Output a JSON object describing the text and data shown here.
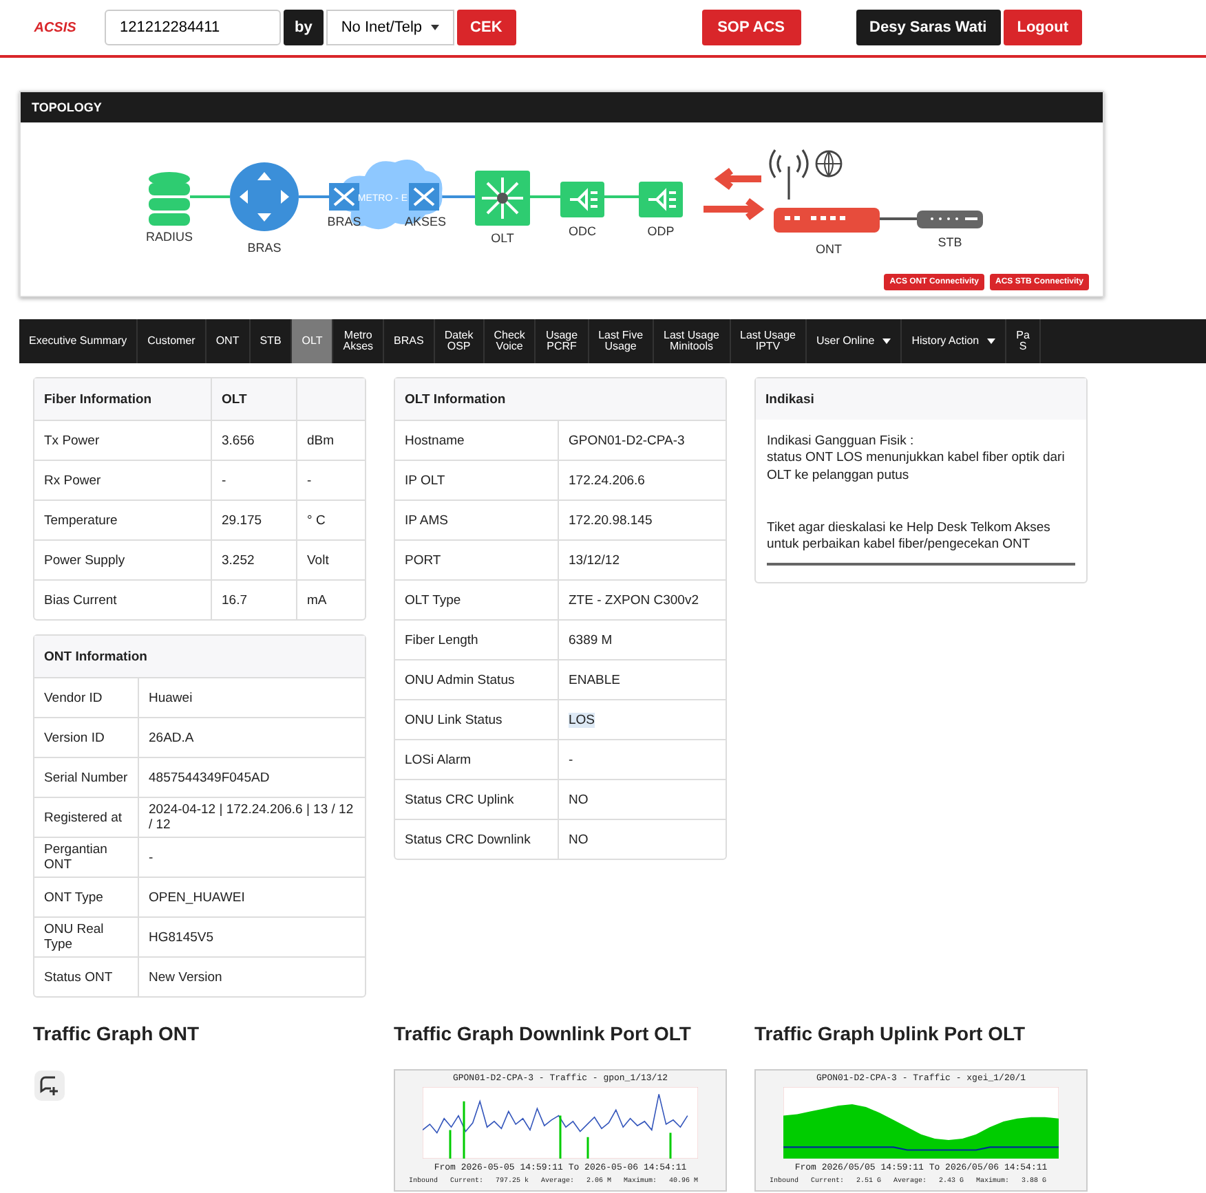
{
  "header": {
    "logo": "ACSIS",
    "search": {
      "value": "121212284411"
    },
    "by_label": "by",
    "search_type": "No Inet/Telp",
    "check_button": "CEK",
    "sop_button": "SOP ACS",
    "user_name": "Desy Saras Wati",
    "logout_button": "Logout"
  },
  "topology": {
    "title": "TOPOLOGY",
    "labels": {
      "radius": "RADIUS",
      "bras": "BRAS",
      "metro_bras": "BRAS",
      "metro": "METRO - E",
      "metro_akses": "AKSES",
      "olt": "OLT",
      "odc": "ODC",
      "odp": "ODP",
      "ont": "ONT",
      "stb": "STB"
    },
    "buttons": [
      "ACS ONT Connectivity",
      "ACS STB Connectivity"
    ]
  },
  "tabs": [
    {
      "label": "Executive Summary",
      "selected": false,
      "dropdown": false
    },
    {
      "label": "Customer",
      "selected": false,
      "dropdown": false
    },
    {
      "label": "ONT",
      "selected": false,
      "dropdown": false
    },
    {
      "label": "STB",
      "selected": false,
      "dropdown": false
    },
    {
      "label": "OLT",
      "selected": true,
      "dropdown": false
    },
    {
      "label": "Metro\nAkses",
      "selected": false,
      "dropdown": false
    },
    {
      "label": "BRAS",
      "selected": false,
      "dropdown": false
    },
    {
      "label": "Datek\nOSP",
      "selected": false,
      "dropdown": false
    },
    {
      "label": "Check\nVoice",
      "selected": false,
      "dropdown": false
    },
    {
      "label": "Usage\nPCRF",
      "selected": false,
      "dropdown": false
    },
    {
      "label": "Last Five\nUsage",
      "selected": false,
      "dropdown": false
    },
    {
      "label": "Last Usage\nMinitools",
      "selected": false,
      "dropdown": false
    },
    {
      "label": "Last Usage\nIPTV",
      "selected": false,
      "dropdown": false
    },
    {
      "label": "User Online",
      "selected": false,
      "dropdown": true
    },
    {
      "label": "History Action",
      "selected": false,
      "dropdown": true
    },
    {
      "label": "Pa\nS",
      "selected": false,
      "dropdown": false
    }
  ],
  "fiber_info": {
    "headers": [
      "Fiber Information",
      "OLT"
    ],
    "rows": [
      {
        "label": "Tx Power",
        "value": "3.656",
        "unit": "dBm"
      },
      {
        "label": "Rx Power",
        "value": "-",
        "unit": "-"
      },
      {
        "label": "Temperature",
        "value": "29.175",
        "unit": "° C"
      },
      {
        "label": "Power Supply",
        "value": "3.252",
        "unit": "Volt"
      },
      {
        "label": "Bias Current",
        "value": "16.7",
        "unit": "mA"
      }
    ]
  },
  "ont_info": {
    "title": "ONT Information",
    "rows": [
      {
        "label": "Vendor ID",
        "value": "Huawei"
      },
      {
        "label": "Version ID",
        "value": "26AD.A"
      },
      {
        "label": "Serial Number",
        "value": "4857544349F045AD"
      },
      {
        "label": "Registered at",
        "value": "2024-04-12 | 172.24.206.6 | 13 / 12 / 12"
      },
      {
        "label": "Pergantian ONT",
        "value": "-"
      },
      {
        "label": "ONT Type",
        "value": "OPEN_HUAWEI"
      },
      {
        "label": "ONU Real Type",
        "value": "HG8145V5"
      },
      {
        "label": "Status ONT",
        "value": "New Version"
      }
    ]
  },
  "olt_info": {
    "title": "OLT Information",
    "rows": [
      {
        "label": "Hostname",
        "value": "GPON01-D2-CPA-3",
        "highlighted": false
      },
      {
        "label": "IP OLT",
        "value": "172.24.206.6",
        "highlighted": false
      },
      {
        "label": "IP AMS",
        "value": "172.20.98.145",
        "highlighted": false
      },
      {
        "label": "PORT",
        "value": "13/12/12",
        "highlighted": false
      },
      {
        "label": "OLT Type",
        "value": "ZTE - ZXPON C300v2",
        "highlighted": false
      },
      {
        "label": "Fiber Length",
        "value": "6389 M",
        "highlighted": false
      },
      {
        "label": "ONU Admin Status",
        "value": "ENABLE",
        "highlighted": false
      },
      {
        "label": "ONU Link Status",
        "value": "LOS",
        "highlighted": true
      },
      {
        "label": "LOSi Alarm",
        "value": "-",
        "highlighted": false
      },
      {
        "label": "Status CRC Uplink",
        "value": "NO",
        "highlighted": false
      },
      {
        "label": "Status CRC Downlink",
        "value": "NO",
        "highlighted": false
      }
    ]
  },
  "indikasi": {
    "title": "Indikasi",
    "lines": [
      "Indikasi Gangguan Fisik :",
      "status ONT LOS menunjukkan kabel fiber optik dari OLT ke pelanggan putus"
    ],
    "note": "Tiket agar dieskalasi ke Help Desk Telkom Akses untuk perbaikan kabel fiber/pengecekan ONT"
  },
  "graphs": [
    {
      "title": "Traffic Graph ONT",
      "kind": "empty"
    },
    {
      "title": "Traffic Graph Downlink Port OLT",
      "kind": "line",
      "graph_title": "GPON01-D2-CPA-3 - Traffic - gpon_1/13/12",
      "period": "From 2026-05-05 14:59:11 To 2026-05-06 14:54:11",
      "legend": "Inbound   Current:   797.25 k   Average:   2.06 M   Maximum:   40.96 M"
    },
    {
      "title": "Traffic Graph Uplink Port OLT",
      "kind": "area",
      "graph_title": "GPON01-D2-CPA-3 - Traffic - xgei_1/20/1",
      "period": "From 2026/05/05 14:59:11 To 2026/05/06 14:54:11",
      "legend": "Inbound   Current:   2.51 G   Average:   2.43 G   Maximum:   3.88 G"
    }
  ]
}
